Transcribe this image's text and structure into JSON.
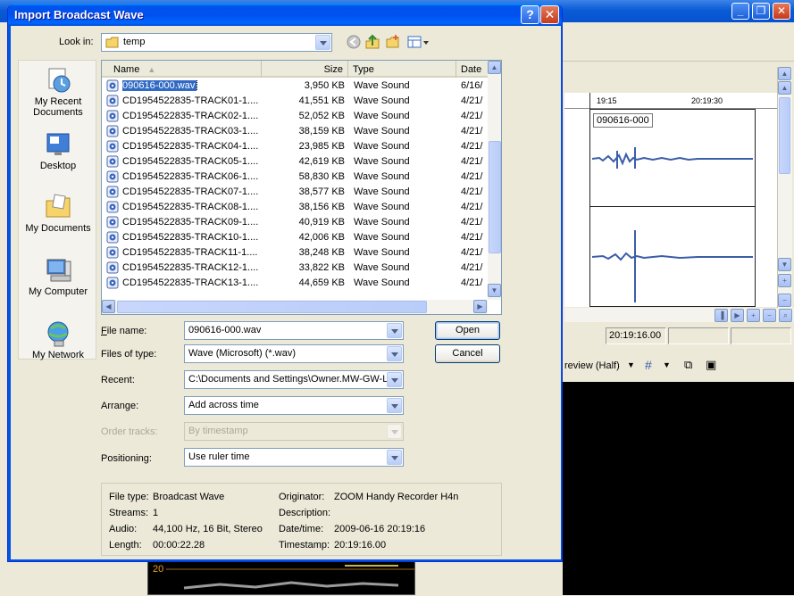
{
  "dialog": {
    "title": "Import Broadcast Wave",
    "help_btn": "?",
    "close_btn": "X"
  },
  "lookin": {
    "label": "Look in:",
    "value": "temp"
  },
  "places": [
    {
      "label": "My Recent\nDocuments",
      "icon": "recent-documents-icon"
    },
    {
      "label": "Desktop",
      "icon": "desktop-icon"
    },
    {
      "label": "My Documents",
      "icon": "my-documents-icon"
    },
    {
      "label": "My Computer",
      "icon": "my-computer-icon"
    },
    {
      "label": "My Network",
      "icon": "my-network-icon"
    }
  ],
  "filelist": {
    "columns": [
      "Name",
      "Size",
      "Type",
      "Date"
    ],
    "rows": [
      {
        "name": "090616-000.wav",
        "size": "3,950 KB",
        "type": "Wave Sound",
        "date": "6/16/",
        "selected": true
      },
      {
        "name": "CD1954522835-TRACK01-1....",
        "size": "41,551 KB",
        "type": "Wave Sound",
        "date": "4/21/"
      },
      {
        "name": "CD1954522835-TRACK02-1....",
        "size": "52,052 KB",
        "type": "Wave Sound",
        "date": "4/21/"
      },
      {
        "name": "CD1954522835-TRACK03-1....",
        "size": "38,159 KB",
        "type": "Wave Sound",
        "date": "4/21/"
      },
      {
        "name": "CD1954522835-TRACK04-1....",
        "size": "23,985 KB",
        "type": "Wave Sound",
        "date": "4/21/"
      },
      {
        "name": "CD1954522835-TRACK05-1....",
        "size": "42,619 KB",
        "type": "Wave Sound",
        "date": "4/21/"
      },
      {
        "name": "CD1954522835-TRACK06-1....",
        "size": "58,830 KB",
        "type": "Wave Sound",
        "date": "4/21/"
      },
      {
        "name": "CD1954522835-TRACK07-1....",
        "size": "38,577 KB",
        "type": "Wave Sound",
        "date": "4/21/"
      },
      {
        "name": "CD1954522835-TRACK08-1....",
        "size": "38,156 KB",
        "type": "Wave Sound",
        "date": "4/21/"
      },
      {
        "name": "CD1954522835-TRACK09-1....",
        "size": "40,919 KB",
        "type": "Wave Sound",
        "date": "4/21/"
      },
      {
        "name": "CD1954522835-TRACK10-1....",
        "size": "42,006 KB",
        "type": "Wave Sound",
        "date": "4/21/"
      },
      {
        "name": "CD1954522835-TRACK11-1....",
        "size": "38,248 KB",
        "type": "Wave Sound",
        "date": "4/21/"
      },
      {
        "name": "CD1954522835-TRACK12-1....",
        "size": "33,822 KB",
        "type": "Wave Sound",
        "date": "4/21/"
      },
      {
        "name": "CD1954522835-TRACK13-1....",
        "size": "44,659 KB",
        "type": "Wave Sound",
        "date": "4/21/"
      }
    ]
  },
  "form": {
    "file_name": {
      "label": "File name:",
      "value": "090616-000.wav"
    },
    "files_of_type": {
      "label": "Files of type:",
      "value": "Wave (Microsoft) (*.wav)"
    },
    "recent": {
      "label": "Recent:",
      "value": "C:\\Documents and Settings\\Owner.MW-GW-LT"
    },
    "arrange": {
      "label": "Arrange:",
      "value": "Add across time"
    },
    "order_tracks": {
      "label": "Order tracks:",
      "value": "By timestamp"
    },
    "positioning": {
      "label": "Positioning:",
      "value": "Use ruler time"
    }
  },
  "buttons": {
    "open": "Open",
    "cancel": "Cancel"
  },
  "info": {
    "file_type_k": "File type:",
    "file_type_v": "Broadcast Wave",
    "streams_k": "Streams:",
    "streams_v": "1",
    "audio_k": "Audio:",
    "audio_v": "44,100 Hz, 16 Bit, Stereo",
    "length_k": "Length:",
    "length_v": "00:00:22.28",
    "originator_k": "Originator:",
    "originator_v": "ZOOM Handy Recorder H4n",
    "description_k": "Description:",
    "description_v": "",
    "datetime_k": "Date/time:",
    "datetime_v": "2009-06-16  20:19:16",
    "timestamp_k": "Timestamp:",
    "timestamp_v": "20:19:16.00"
  },
  "background": {
    "ruler_ticks": [
      "19:15",
      "20:19:30"
    ],
    "clip_label": "090616-000",
    "status_time": "20:19:16.00",
    "preview_label": "review (Half)",
    "vu_value": "20"
  },
  "colors": {
    "titlebar": "#0054e3",
    "selection": "#316ac5",
    "waveform": "#3b5ea8"
  }
}
